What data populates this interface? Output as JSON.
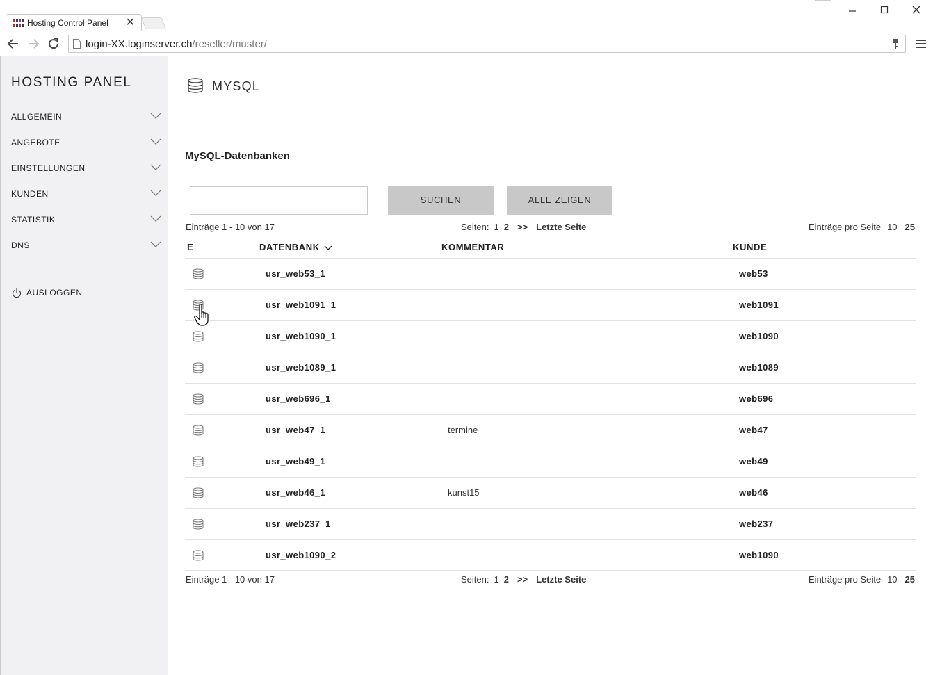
{
  "browser": {
    "tab_title": "Hosting Control Panel",
    "url_host": "login-XX.loginserver.ch",
    "url_path": "/reseller/muster/"
  },
  "sidebar": {
    "brand": "HOSTING PANEL",
    "items": [
      {
        "label": "ALLGEMEIN"
      },
      {
        "label": "ANGEBOTE"
      },
      {
        "label": "EINSTELLUNGEN"
      },
      {
        "label": "KUNDEN"
      },
      {
        "label": "STATISTIK"
      },
      {
        "label": "DNS"
      }
    ],
    "logout_label": "AUSLOGGEN"
  },
  "main": {
    "title": "MYSQL",
    "section_title": "MySQL-Datenbanken",
    "search": {
      "value": "",
      "placeholder": ""
    },
    "search_button": "SUCHEN",
    "show_all_button": "ALLE ZEIGEN",
    "pager": {
      "entries": "Einträge 1 - 10 von 17",
      "pages_label": "Seiten:",
      "page_1": "1",
      "page_2": "2",
      "next": ">>",
      "last": "Letzte Seite",
      "per_page_label": "Einträge pro Seite",
      "per_page_10": "10",
      "per_page_25": "25"
    },
    "columns": {
      "e": "E",
      "datenbank": "DATENBANK",
      "kommentar": "KOMMENTAR",
      "kunde": "KUNDE"
    },
    "rows": [
      {
        "db": "usr_web53_1",
        "comment": "",
        "kunde": "web53"
      },
      {
        "db": "usr_web1091_1",
        "comment": "",
        "kunde": "web1091"
      },
      {
        "db": "usr_web1090_1",
        "comment": "",
        "kunde": "web1090"
      },
      {
        "db": "usr_web1089_1",
        "comment": "",
        "kunde": "web1089"
      },
      {
        "db": "usr_web696_1",
        "comment": "",
        "kunde": "web696"
      },
      {
        "db": "usr_web47_1",
        "comment": "termine",
        "kunde": "web47"
      },
      {
        "db": "usr_web49_1",
        "comment": "",
        "kunde": "web49"
      },
      {
        "db": "usr_web46_1",
        "comment": "kunst15",
        "kunde": "web46"
      },
      {
        "db": "usr_web237_1",
        "comment": "",
        "kunde": "web237"
      },
      {
        "db": "usr_web1090_2",
        "comment": "",
        "kunde": "web1090"
      }
    ]
  },
  "icons": {
    "tab_favicon": "hosting-logo-icon",
    "row_icon": "database-icon",
    "header_icon": "database-icon",
    "logout_icon": "power-icon",
    "chevron": "chevron-down-icon",
    "cursor": "hand-pointer-icon"
  },
  "colors": {
    "sidebar_bg": "#f1f1f3",
    "button_bg": "#c8c8c8",
    "rule": "#e2e2e2"
  }
}
